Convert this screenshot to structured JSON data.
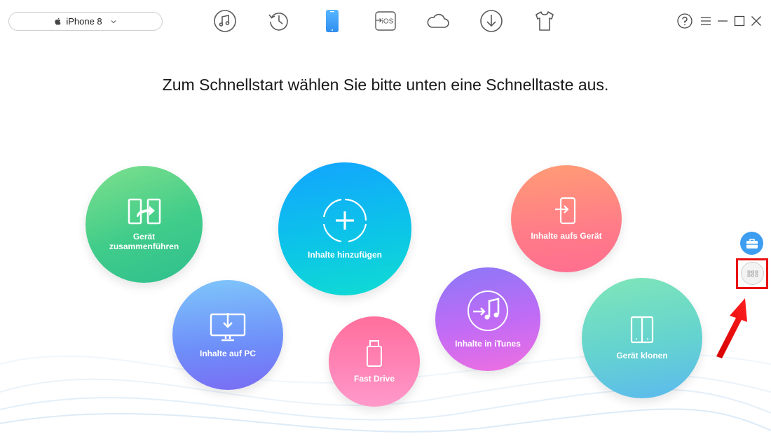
{
  "device": {
    "name": "iPhone 8",
    "icon": "apple-icon",
    "dropdown_icon": "chevron-down-icon"
  },
  "nav": [
    {
      "id": "music",
      "icon": "music-note-icon"
    },
    {
      "id": "history",
      "icon": "history-clock-icon"
    },
    {
      "id": "device",
      "icon": "iphone-icon",
      "active": true
    },
    {
      "id": "ios-mover",
      "icon": "ios-mover-icon",
      "label": "iOS"
    },
    {
      "id": "icloud",
      "icon": "cloud-icon"
    },
    {
      "id": "download",
      "icon": "download-icon"
    },
    {
      "id": "shop",
      "icon": "tshirt-icon"
    }
  ],
  "window_controls": [
    "help-icon",
    "menu-icon",
    "minimize-icon",
    "maximize-icon",
    "close-icon"
  ],
  "headline": "Zum Schnellstart wählen Sie bitte unten eine Schnelltaste aus.",
  "shortcuts": {
    "merge": {
      "label": "Gerät zusammenführen",
      "icon": "merge-devices-icon"
    },
    "add": {
      "label": "Inhalte hinzufügen",
      "icon": "add-content-icon"
    },
    "todev": {
      "label": "Inhalte aufs Gerät",
      "icon": "content-to-device-icon"
    },
    "topc": {
      "label": "Inhalte auf PC",
      "icon": "content-to-pc-icon"
    },
    "fast": {
      "label": "Fast Drive",
      "icon": "usb-drive-icon"
    },
    "itunes": {
      "label": "Inhalte in iTunes",
      "icon": "content-to-itunes-icon"
    },
    "clone": {
      "label": "Gerät klonen",
      "icon": "clone-device-icon"
    }
  },
  "side": {
    "toolbox_icon": "toolbox-icon",
    "apps_icon": "app-grid-icon"
  },
  "colors": {
    "accent": "#3d9df0",
    "highlight": "#e81010",
    "icon_gray": "#5a5a5a",
    "active_blue": "#3a9ff5"
  }
}
